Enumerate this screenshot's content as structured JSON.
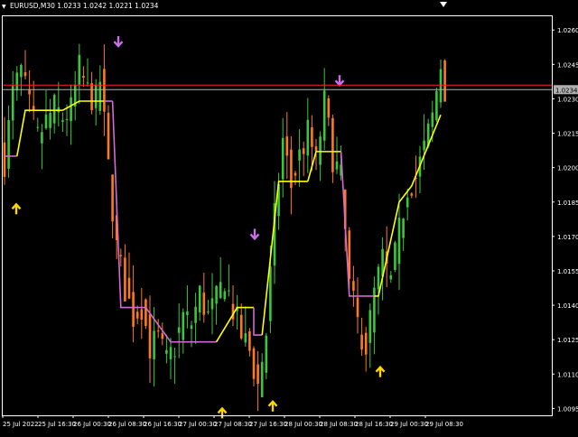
{
  "header": {
    "symbol_timeframe": "EURUSD,M30",
    "ohlc": "1.0233 1.0242 1.0221 1.0234"
  },
  "colors": {
    "background": "#000000",
    "frame": "#ffffff",
    "candle_up": "#3cc63c",
    "candle_down": "#ff7a1a",
    "line_bull": "#ffff00",
    "line_bear": "#d26ad2",
    "arrow_up": "#ffd700",
    "arrow_down": "#c86ee6",
    "bid_line": "#b0b0b0",
    "ask_line": "#ff2020",
    "price_tag_bg": "#b0b0b0"
  },
  "current_price_tag": "1.0234",
  "chart_data": {
    "type": "candlestick",
    "title": "EURUSD,M30",
    "xlabel": "",
    "ylabel": "",
    "ylim": [
      1.0092,
      1.0266
    ],
    "y_ticks": [
      "1.0260",
      "1.0245",
      "1.0230",
      "1.0215",
      "1.0200",
      "1.0185",
      "1.0170",
      "1.0155",
      "1.0140",
      "1.0125",
      "1.0110",
      "1.0095"
    ],
    "y_tick_values": [
      1.026,
      1.0245,
      1.023,
      1.0215,
      1.02,
      1.0185,
      1.017,
      1.0155,
      1.014,
      1.0125,
      1.011,
      1.0095
    ],
    "x_ticks": [
      "25 Jul 2022",
      "25 Jul 16:30",
      "26 Jul 00:30",
      "26 Jul 08:30",
      "26 Jul 16:30",
      "27 Jul 00:30",
      "27 Jul 08:30",
      "27 Jul 16:30",
      "28 Jul 00:30",
      "28 Jul 08:30",
      "28 Jul 16:30",
      "29 Jul 00:30",
      "29 Jul 08:30"
    ],
    "bid_price": 1.0234,
    "ask_price": 1.0236,
    "close_path": [
      [
        0,
        1.0203
      ],
      [
        2,
        1.0232
      ],
      [
        4,
        1.0242
      ],
      [
        6,
        1.0226
      ],
      [
        8,
        1.0213
      ],
      [
        10,
        1.022
      ],
      [
        12,
        1.0226
      ],
      [
        14,
        1.0222
      ],
      [
        16,
        1.0225
      ],
      [
        18,
        1.0243
      ],
      [
        20,
        1.0233
      ],
      [
        22,
        1.0229
      ],
      [
        23,
        1.0238
      ],
      [
        25,
        1.02
      ],
      [
        27,
        1.0165
      ],
      [
        29,
        1.0147
      ],
      [
        31,
        1.0135
      ],
      [
        33,
        1.014
      ],
      [
        35,
        1.0122
      ],
      [
        37,
        1.0125
      ],
      [
        39,
        1.0115
      ],
      [
        41,
        1.0122
      ],
      [
        43,
        1.0135
      ],
      [
        45,
        1.0132
      ],
      [
        47,
        1.0145
      ],
      [
        49,
        1.0135
      ],
      [
        51,
        1.0142
      ],
      [
        53,
        1.0152
      ],
      [
        55,
        1.0138
      ],
      [
        57,
        1.0127
      ],
      [
        59,
        1.012
      ],
      [
        61,
        1.0105
      ],
      [
        63,
        1.0128
      ],
      [
        65,
        1.0178
      ],
      [
        67,
        1.0212
      ],
      [
        69,
        1.0192
      ],
      [
        71,
        1.0205
      ],
      [
        73,
        1.0215
      ],
      [
        75,
        1.0202
      ],
      [
        77,
        1.0228
      ],
      [
        79,
        1.0205
      ],
      [
        81,
        1.0195
      ],
      [
        83,
        1.0148
      ],
      [
        85,
        1.0132
      ],
      [
        87,
        1.0122
      ],
      [
        89,
        1.0145
      ],
      [
        91,
        1.016
      ],
      [
        93,
        1.015
      ],
      [
        95,
        1.0172
      ],
      [
        97,
        1.0192
      ],
      [
        99,
        1.0196
      ],
      [
        101,
        1.0208
      ],
      [
        103,
        1.0222
      ],
      [
        105,
        1.0245
      ],
      [
        106,
        1.0234
      ]
    ],
    "indicator": [
      {
        "value": 1.0205,
        "side": "bear",
        "segment": "step-1"
      },
      {
        "value": 1.0225,
        "side": "bull",
        "segment": "step-2"
      },
      {
        "value": 1.0229,
        "side": "bull",
        "segment": "step-3"
      },
      {
        "value": 1.0229,
        "side": "bear",
        "segment": "step-4"
      },
      {
        "value": 1.0139,
        "side": "bear",
        "segment": "step-5"
      },
      {
        "value": 1.0124,
        "side": "bear",
        "segment": "step-6"
      },
      {
        "value": 1.0139,
        "side": "bull",
        "segment": "step-7"
      },
      {
        "value": 1.0127,
        "side": "bear",
        "segment": "step-8"
      },
      {
        "value": 1.0194,
        "side": "bull",
        "segment": "step-9"
      },
      {
        "value": 1.0207,
        "side": "bull",
        "segment": "step-10"
      },
      {
        "value": 1.0144,
        "side": "bear",
        "segment": "step-11"
      },
      {
        "value": 1.0223,
        "side": "bull",
        "segment": "step-12"
      }
    ],
    "signals": [
      {
        "type": "buy",
        "price": 1.0184
      },
      {
        "type": "sell",
        "price": 1.0253
      },
      {
        "type": "buy",
        "price": 1.0095
      },
      {
        "type": "sell",
        "price": 1.0169
      },
      {
        "type": "buy",
        "price": 1.0098
      },
      {
        "type": "sell",
        "price": 1.0236
      },
      {
        "type": "buy",
        "price": 1.0113
      }
    ]
  }
}
